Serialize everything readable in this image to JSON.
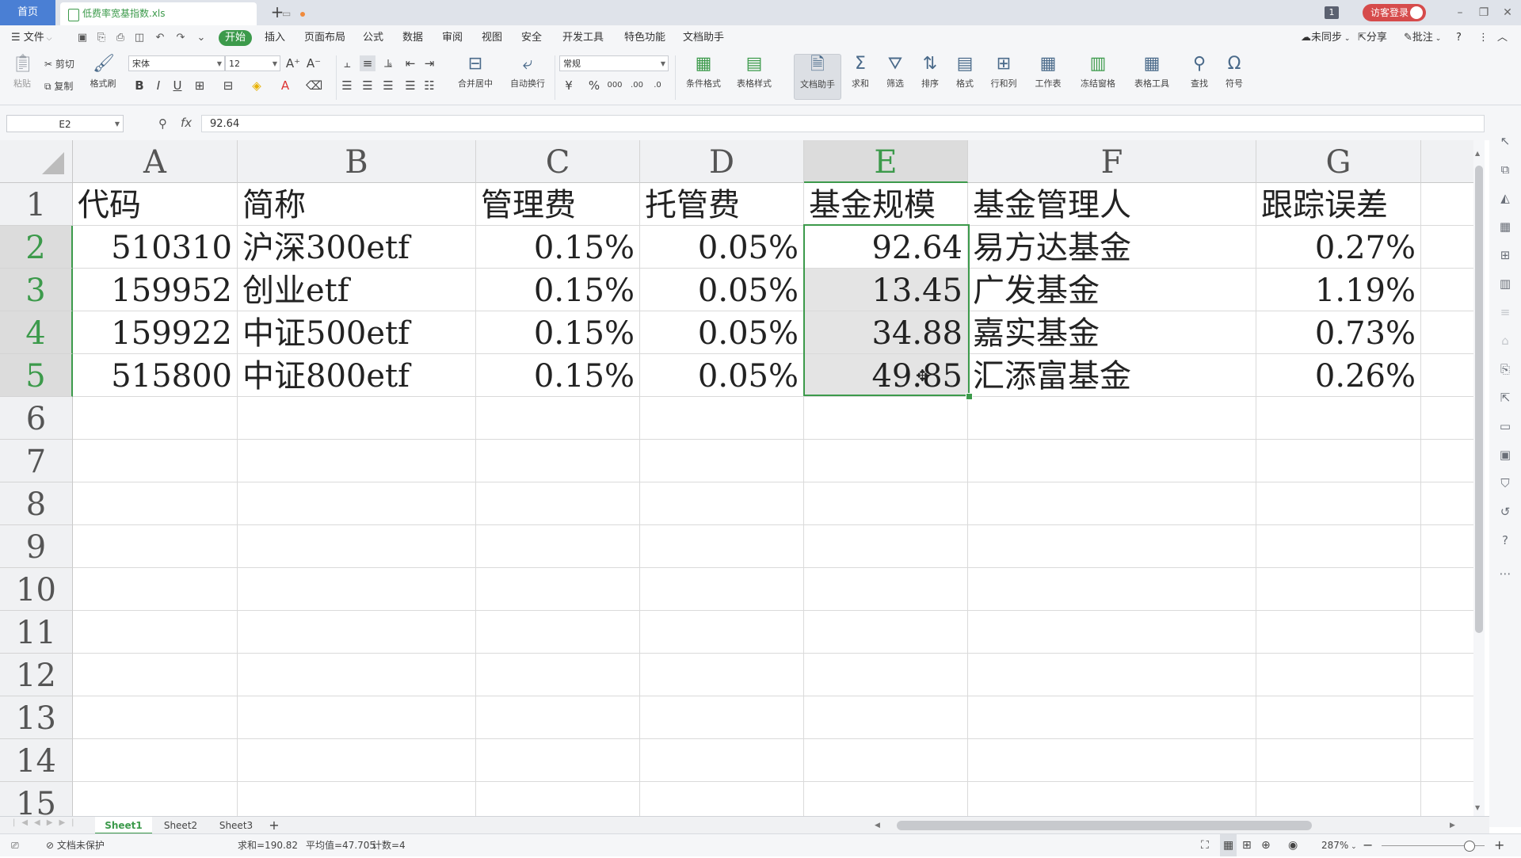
{
  "titlebar": {
    "home_tab": "首页",
    "file_tab": "低费率宽基指数.xls",
    "tab_counter": "1",
    "login": "访客登录",
    "win_min": "–",
    "win_max": "❐",
    "win_close": "✕"
  },
  "menu": {
    "file": "文件",
    "items": [
      "开始",
      "插入",
      "页面布局",
      "公式",
      "数据",
      "审阅",
      "视图",
      "安全",
      "开发工具",
      "特色功能",
      "文档助手"
    ],
    "sync": "未同步",
    "share": "分享",
    "comment": "批注"
  },
  "ribbon": {
    "paste": "粘贴",
    "cut": "剪切",
    "copy": "复制",
    "format_painter": "格式刷",
    "font_name": "宋体",
    "font_size": "12",
    "merge_center": "合并居中",
    "wrap_text": "自动换行",
    "number_format": "常规",
    "cond_format": "条件格式",
    "table_style": "表格样式",
    "doc_helper": "文档助手",
    "sum": "求和",
    "filter": "筛选",
    "sort": "排序",
    "format": "格式",
    "row_col": "行和列",
    "worksheet": "工作表",
    "freeze": "冻结窗格",
    "table_tools": "表格工具",
    "find": "查找",
    "symbol": "符号"
  },
  "formula_bar": {
    "name_box": "E2",
    "fx": "fx",
    "value": "92.64"
  },
  "grid": {
    "columns": [
      "A",
      "B",
      "C",
      "D",
      "E",
      "F",
      "G"
    ],
    "row_numbers": [
      "1",
      "2",
      "3",
      "4",
      "5",
      "6",
      "7",
      "8",
      "9",
      "10",
      "11",
      "12",
      "13",
      "14",
      "15"
    ],
    "rows": [
      [
        "代码",
        "简称",
        "管理费",
        "托管费",
        "基金规模",
        "基金管理人",
        "跟踪误差"
      ],
      [
        "510310",
        "沪深300etf",
        "0.15%",
        "0.05%",
        "92.64",
        "易方达基金",
        "0.27%"
      ],
      [
        "159952",
        "创业etf",
        "0.15%",
        "0.05%",
        "13.45",
        "广发基金",
        "1.19%"
      ],
      [
        "159922",
        "中证500etf",
        "0.15%",
        "0.05%",
        "34.88",
        "嘉实基金",
        "0.73%"
      ],
      [
        "515800",
        "中证800etf",
        "0.15%",
        "0.05%",
        "49.85",
        "汇添富基金",
        "0.26%"
      ]
    ],
    "selected_column": "E",
    "selected_range": "E2:E5"
  },
  "sheets": [
    "Sheet1",
    "Sheet2",
    "Sheet3"
  ],
  "active_sheet": "Sheet1",
  "status": {
    "protect": "文档未保护",
    "sum": "求和=190.82",
    "avg": "平均值=47.705",
    "count": "计数=4",
    "zoom": "287%"
  },
  "colors": {
    "accent_green": "#3c9a4b",
    "home_tab_blue": "#4a7fd4",
    "login_red": "#d64b4b"
  }
}
